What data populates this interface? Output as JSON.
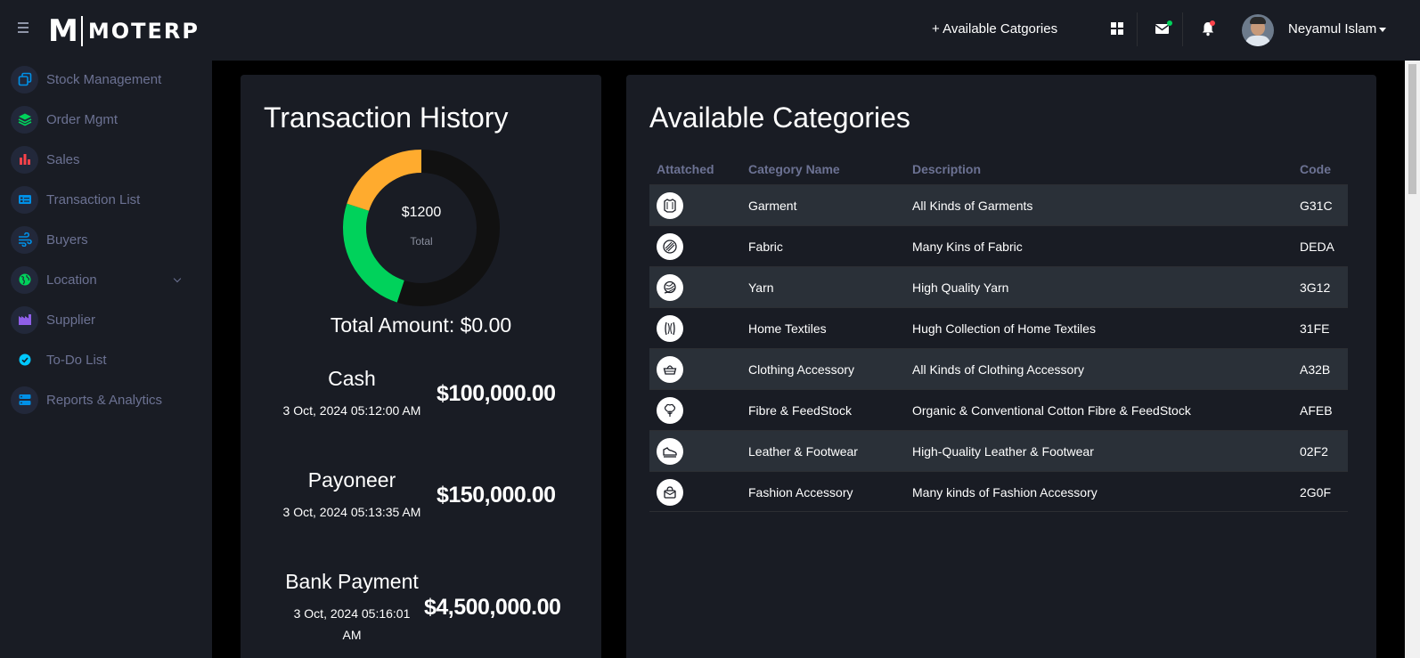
{
  "header": {
    "logo_m": "M",
    "logo_text": "MOTERP",
    "nav_link": "+ Available Catgories",
    "user_name": "Neyamul Islam",
    "colors": {
      "mail_dot": "#00d25b",
      "bell_dot": "#fc424a"
    }
  },
  "sidebar": {
    "items": [
      {
        "label": "Stock Management",
        "icon": "stack-copy-icon",
        "color": "#0090e7"
      },
      {
        "label": "Order Mgmt",
        "icon": "layers-icon",
        "color": "#00d25b"
      },
      {
        "label": "Sales",
        "icon": "bar-chart-icon",
        "color": "#fc424a"
      },
      {
        "label": "Transaction List",
        "icon": "card-list-icon",
        "color": "#0090e7"
      },
      {
        "label": "Buyers",
        "icon": "wind-icon",
        "color": "#0090e7"
      },
      {
        "label": "Location",
        "icon": "globe-icon",
        "color": "#00d25b"
      },
      {
        "label": "Supplier",
        "icon": "factory-icon",
        "color": "#8f5fe8"
      },
      {
        "label": "To-Do List",
        "icon": "check-circle-icon",
        "color": "#00c8ff"
      },
      {
        "label": "Reports & Analytics",
        "icon": "server-icon",
        "color": "#0090e7"
      }
    ]
  },
  "transactions": {
    "title": "Transaction History",
    "donut": {
      "center_value": "$1200",
      "center_label": "Total",
      "segments": [
        {
          "value": 55,
          "color": "#111111"
        },
        {
          "value": 25,
          "color": "#00d25b"
        },
        {
          "value": 20,
          "color": "#ffab2e"
        }
      ]
    },
    "total_amount": "Total Amount: $0.00",
    "items": [
      {
        "name": "Cash",
        "date": "3 Oct, 2024 05:12:00 AM",
        "amount": "$100,000.00"
      },
      {
        "name": "Payoneer",
        "date": "3 Oct, 2024 05:13:35 AM",
        "amount": "$150,000.00"
      },
      {
        "name": "Bank Payment",
        "date_line1": "3 Oct, 2024 05:16:01",
        "date_line2": "AM",
        "amount": "$4,500,000.00"
      }
    ]
  },
  "categories": {
    "title": "Available Categories",
    "columns": [
      "Attatched",
      "Category Name",
      "Description",
      "Code"
    ],
    "rows": [
      {
        "icon": "shirt-icon",
        "name": "Garment",
        "description": "All Kinds of Garments",
        "code": "G31C"
      },
      {
        "icon": "fabric-icon",
        "name": "Fabric",
        "description": "Many Kins of Fabric",
        "code": "DEDA"
      },
      {
        "icon": "yarn-icon",
        "name": "Yarn",
        "description": "High Quality Yarn",
        "code": "3G12"
      },
      {
        "icon": "home-textile-icon",
        "name": "Home Textiles",
        "description": "Hugh Collection of Home Textiles",
        "code": "31FE"
      },
      {
        "icon": "sewing-basket-icon",
        "name": "Clothing Accessory",
        "description": "All Kinds of Clothing Accessory",
        "code": "A32B"
      },
      {
        "icon": "cotton-plant-icon",
        "name": "Fibre & FeedStock",
        "description": "Organic & Conventional Cotton Fibre & FeedStock",
        "code": "AFEB"
      },
      {
        "icon": "shoe-icon",
        "name": "Leather & Footwear",
        "description": "High-Quality Leather & Footwear",
        "code": "02F2"
      },
      {
        "icon": "handbag-icon",
        "name": "Fashion Accessory",
        "description": "Many kinds of Fashion Accessory",
        "code": "2G0F"
      }
    ]
  }
}
